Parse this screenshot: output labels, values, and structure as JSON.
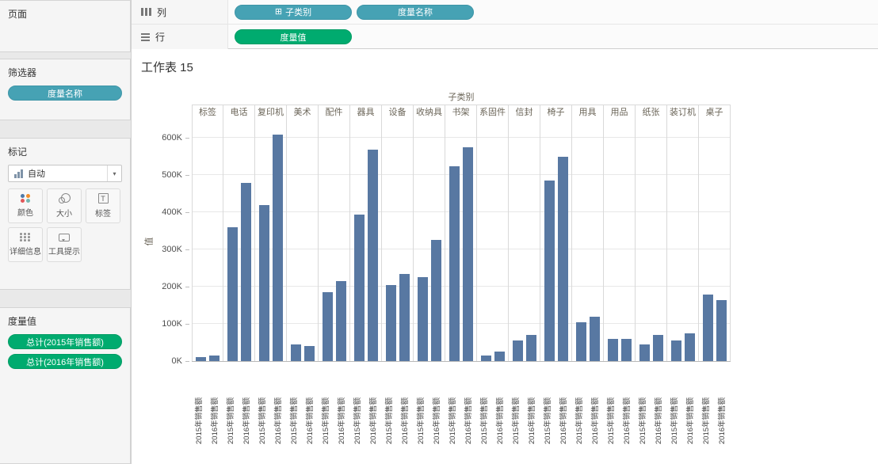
{
  "sidebar": {
    "pages": {
      "title": "页面"
    },
    "filters": {
      "title": "筛选器",
      "pill": "度量名称"
    },
    "marks": {
      "title": "标记",
      "type_selector": {
        "value": "自动",
        "caret": "▾"
      },
      "buttons": [
        {
          "id": "color",
          "label": "颜色"
        },
        {
          "id": "size",
          "label": "大小"
        },
        {
          "id": "label",
          "label": "标签"
        },
        {
          "id": "detail",
          "label": "详细信息"
        },
        {
          "id": "tooltip",
          "label": "工具提示"
        }
      ]
    },
    "measure_values": {
      "title": "度量值",
      "pills": [
        "总计(2015年销售额)",
        "总计(2016年销售额)"
      ]
    }
  },
  "shelves": {
    "columns": {
      "label": "列",
      "pills": [
        {
          "text": "子类别",
          "icon": "⊞"
        },
        {
          "text": "度量名称"
        }
      ]
    },
    "rows": {
      "label": "行",
      "pills": [
        {
          "text": "度量值"
        }
      ]
    }
  },
  "sheet": {
    "title": "工作表 15"
  },
  "colors": {
    "dimension_pill": "#46a2b4",
    "measure_pill": "#00ab6f",
    "bar": "#5878a2"
  },
  "chart_data": {
    "type": "bar",
    "field_label": "子类别",
    "ylabel": "值",
    "categories": [
      "标签",
      "电话",
      "复印机",
      "美术",
      "配件",
      "器具",
      "设备",
      "收纳具",
      "书架",
      "系固件",
      "信封",
      "椅子",
      "用具",
      "用品",
      "纸张",
      "装订机",
      "桌子"
    ],
    "series": [
      {
        "name": "2015年销售额",
        "values": [
          10000,
          360000,
          420000,
          45000,
          185000,
          395000,
          205000,
          225000,
          525000,
          15000,
          55000,
          485000,
          105000,
          60000,
          45000,
          55000,
          180000
        ]
      },
      {
        "name": "2016年销售额",
        "values": [
          15000,
          480000,
          610000,
          40000,
          215000,
          570000,
          235000,
          325000,
          575000,
          25000,
          70000,
          550000,
          120000,
          60000,
          70000,
          75000,
          165000
        ]
      }
    ],
    "y_ticks": [
      {
        "label": "0K",
        "value": 0
      },
      {
        "label": "100K",
        "value": 100000
      },
      {
        "label": "200K",
        "value": 200000
      },
      {
        "label": "300K",
        "value": 300000
      },
      {
        "label": "400K",
        "value": 400000
      },
      {
        "label": "500K",
        "value": 500000
      },
      {
        "label": "600K",
        "value": 600000
      }
    ],
    "ylim": [
      0,
      650000
    ],
    "bar_color": "#5878a2",
    "grid": true,
    "legend_position": "none"
  }
}
